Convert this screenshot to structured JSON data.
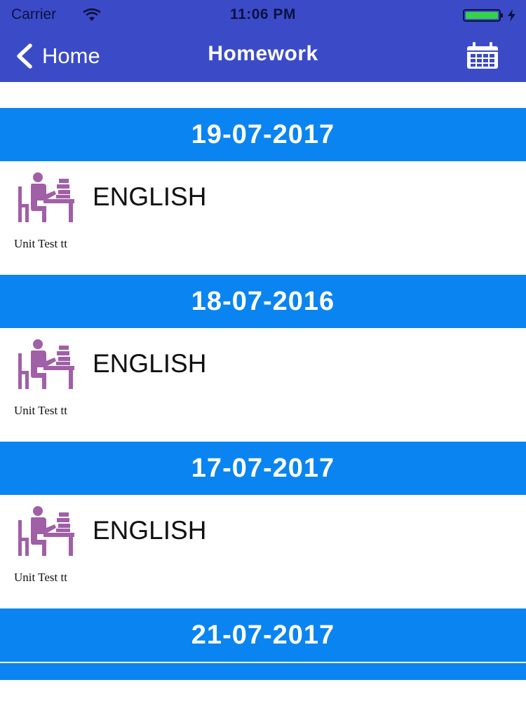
{
  "status_bar": {
    "carrier": "Carrier",
    "time": "11:06 PM",
    "icons": [
      "wifi-icon",
      "battery-icon",
      "charging-bolt-icon"
    ]
  },
  "nav": {
    "back_label": "Home",
    "title": "Homework",
    "right_icon": "calendar-icon"
  },
  "colors": {
    "header_bg": "#3b4bc8",
    "date_band_bg": "#0a84f0",
    "icon_purple": "#a05fa6"
  },
  "homework": [
    {
      "date": "19-07-2017",
      "subject": "ENGLISH",
      "description": "Unit Test tt"
    },
    {
      "date": "18-07-2016",
      "subject": "ENGLISH",
      "description": "Unit Test tt"
    },
    {
      "date": "17-07-2017",
      "subject": "ENGLISH",
      "description": "Unit Test tt"
    },
    {
      "date": "21-07-2017"
    }
  ]
}
